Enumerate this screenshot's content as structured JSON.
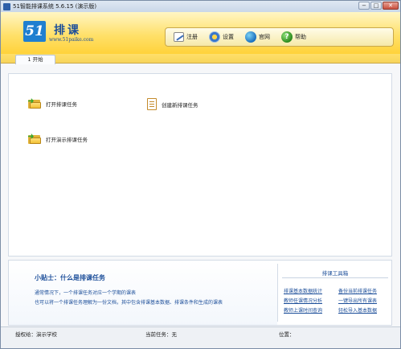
{
  "window": {
    "title": "51智能排课系统 5.6.15 (演示版)",
    "controls": {
      "minimize": "−",
      "maximize": "□",
      "close": "✕"
    }
  },
  "header": {
    "logo_mark": "51",
    "logo_title": "排课",
    "logo_url": "www.51paike.com",
    "toolbar": [
      {
        "label": "注册",
        "icon": "register-pen-icon"
      },
      {
        "label": "设置",
        "icon": "gear-icon"
      },
      {
        "label": "官网",
        "icon": "globe-icon"
      },
      {
        "label": "帮助",
        "icon": "help-icon",
        "glyph": "?"
      }
    ]
  },
  "tabs": [
    {
      "label": "1 开始",
      "active": true
    }
  ],
  "actions": {
    "open_task": "打开排课任务",
    "new_task": "创建新排课任务",
    "open_demo": "打开演示排课任务"
  },
  "tips": {
    "title": "小贴士：什么是排课任务",
    "lines": [
      "通常情况下，一个排课任务对应一个学期的课表",
      "也可以将一个排课任务理解为一份文档，其中包含排课基本数据、排课条件和生成的课表"
    ]
  },
  "toolbox": {
    "title": "排课工具箱",
    "links": [
      "排课基本数据统计",
      "备份当前排课任务",
      "教师任课情况分析",
      "一键导出所有课表",
      "教师上课时间查询",
      "轻松导入基本数据"
    ]
  },
  "status": {
    "license": "授权给：演示学校",
    "current_task": "当前任务：无",
    "position": "位置："
  },
  "colors": {
    "header_yellow": "#ffd23a",
    "brand_blue": "#1d4f9a",
    "logo_blue": "#1f7fd0"
  }
}
